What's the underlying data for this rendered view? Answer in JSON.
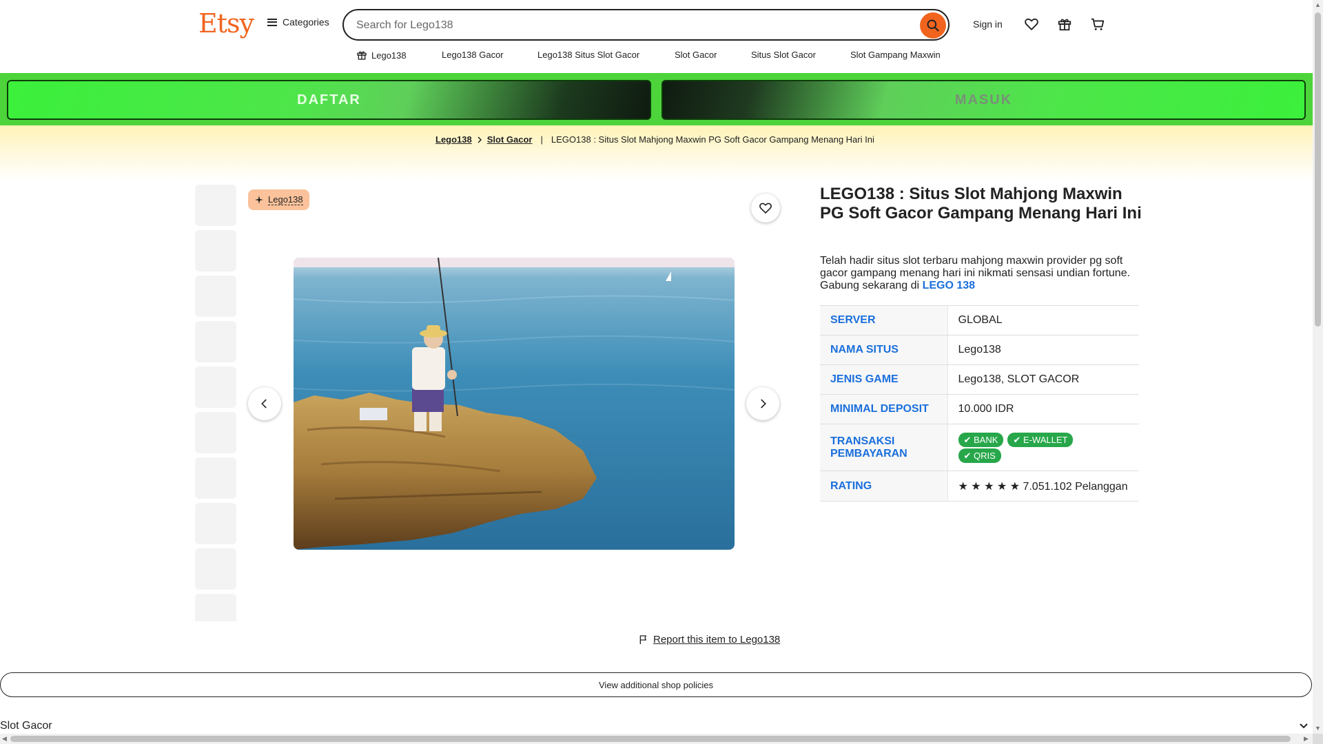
{
  "header": {
    "logo": "Etsy",
    "categories_label": "Categories",
    "search_placeholder": "Search for Lego138",
    "signin_label": "Sign in"
  },
  "category_nav": [
    {
      "label": "Lego138",
      "icon": "gift-icon"
    },
    {
      "label": "Lego138 Gacor"
    },
    {
      "label": "Lego138 Situs Slot Gacor"
    },
    {
      "label": "Slot Gacor"
    },
    {
      "label": "Situs Slot Gacor"
    },
    {
      "label": "Slot Gampang Maxwin"
    }
  ],
  "banner": {
    "daftar_label": "DAFTAR",
    "masuk_label": "MASUK"
  },
  "breadcrumb": {
    "item1": "Lego138",
    "item2": "Slot Gacor",
    "separator": "|",
    "current": "LEGO138 : Situs Slot Mahjong Maxwin PG Soft Gacor Gampang Menang Hari Ini"
  },
  "gallery": {
    "badge_label": "Lego138",
    "thumbnail_count": 10
  },
  "product": {
    "title": "LEGO138 : Situs Slot Mahjong Maxwin PG Soft Gacor Gampang Menang Hari Ini",
    "description": "Telah hadir situs slot terbaru mahjong maxwin provider pg soft gacor gampang menang hari ini nikmati sensasi undian fortune. Gabung sekarang di",
    "description_link": "LEGO 138"
  },
  "specs": [
    {
      "key": "SERVER",
      "value": "GLOBAL"
    },
    {
      "key": "NAMA SITUS",
      "value": "Lego138"
    },
    {
      "key": "JENIS GAME",
      "value": "Lego138, SLOT GACOR"
    },
    {
      "key": "MINIMAL DEPOSIT",
      "value": "10.000 IDR"
    },
    {
      "key": "TRANSAKSI PEMBAYARAN",
      "chips": [
        "✔ BANK",
        "✔ E-WALLET",
        "✔ QRIS"
      ]
    },
    {
      "key": "RATING",
      "value": "★ ★ ★ ★ ★ 7.051.102 Pelanggan"
    }
  ],
  "footer": {
    "report_label": "Report this item to Lego138",
    "policies_label": "View additional shop policies",
    "select_value": "Slot Gacor"
  },
  "colors": {
    "brand_orange": "#f1641e",
    "banner_green": "#4cd43a",
    "link_blue": "#1a6fdc",
    "chip_green": "#27a74a",
    "badge_peach": "#fbc29b"
  }
}
